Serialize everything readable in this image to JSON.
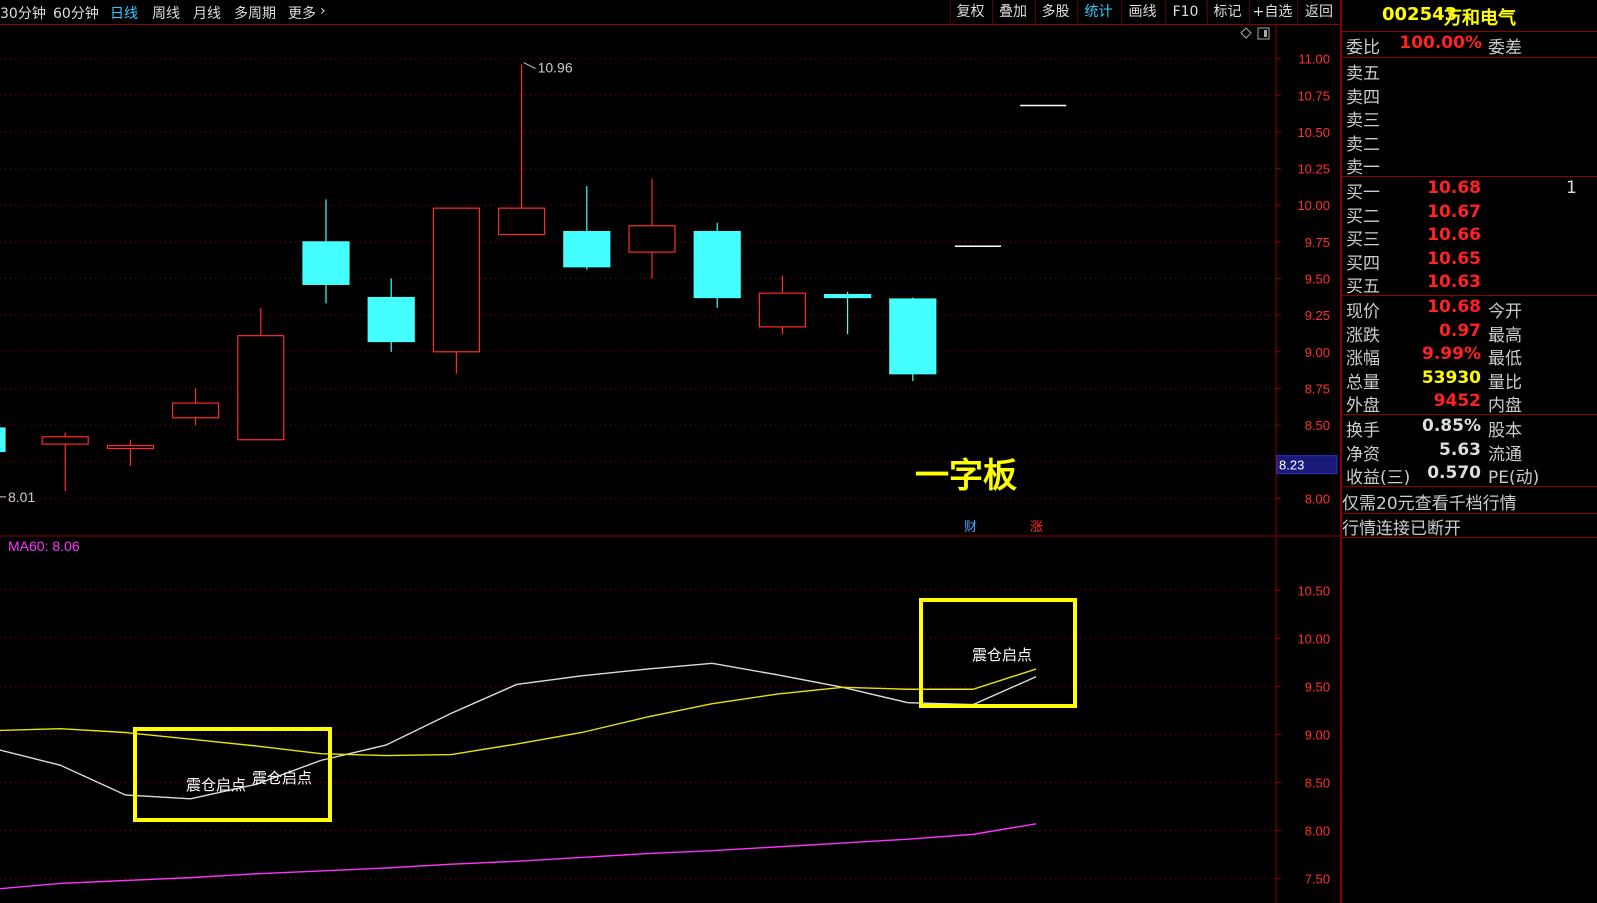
{
  "toolbar": {
    "periods": [
      "30分钟",
      "60分钟",
      "日线",
      "周线",
      "月线",
      "多周期",
      "更多"
    ],
    "active_period": "日线",
    "more_chevron": "›",
    "tools": [
      "复权",
      "叠加",
      "多股",
      "统计",
      "画线",
      "F10",
      "标记",
      "+自选",
      "返回"
    ],
    "active_tool": "统计"
  },
  "colors": {
    "up": "#ff2a2a",
    "down": "#44ffff",
    "grid": "#8b0000",
    "axis_text": "#ff3030",
    "ma_white": "#dddddd",
    "ma_yellow": "#e6e600",
    "ma_magenta": "#ff33ff",
    "highlight_box": "#ffff00"
  },
  "chart_data": [
    {
      "type": "candlestick",
      "ylim": [
        7.9,
        11.1
      ],
      "y_ticks": [
        "11.00",
        "10.75",
        "10.50",
        "10.25",
        "10.00",
        "9.75",
        "9.50",
        "9.25",
        "9.00",
        "8.75",
        "8.50",
        "8.25",
        "8.00"
      ],
      "candles": [
        {
          "open": 8.48,
          "close": 8.32,
          "high": 8.48,
          "low": 8.32
        },
        {
          "open": 8.37,
          "close": 8.42,
          "high": 8.45,
          "low": 8.05
        },
        {
          "open": 8.34,
          "close": 8.36,
          "high": 8.4,
          "low": 8.22
        },
        {
          "open": 8.55,
          "close": 8.65,
          "high": 8.75,
          "low": 8.5
        },
        {
          "open": 8.4,
          "close": 9.11,
          "high": 9.3,
          "low": 8.4
        },
        {
          "open": 9.75,
          "close": 9.46,
          "high": 10.04,
          "low": 9.33
        },
        {
          "open": 9.37,
          "close": 9.07,
          "high": 9.5,
          "low": 9.0
        },
        {
          "open": 9.0,
          "close": 9.98,
          "high": 9.98,
          "low": 8.85
        },
        {
          "open": 9.8,
          "close": 9.98,
          "high": 10.96,
          "low": 9.8
        },
        {
          "open": 9.82,
          "close": 9.58,
          "high": 10.13,
          "low": 9.56
        },
        {
          "open": 9.68,
          "close": 9.86,
          "high": 10.18,
          "low": 9.5
        },
        {
          "open": 9.82,
          "close": 9.37,
          "high": 9.88,
          "low": 9.3
        },
        {
          "open": 9.17,
          "close": 9.4,
          "high": 9.52,
          "low": 9.12
        },
        {
          "open": 9.39,
          "close": 9.37,
          "high": 9.41,
          "low": 9.12
        },
        {
          "open": 9.36,
          "close": 8.85,
          "high": 9.37,
          "low": 8.8
        },
        {
          "open": 9.72,
          "close": 9.72,
          "high": 9.72,
          "low": 9.72
        },
        {
          "open": 10.68,
          "close": 10.68,
          "high": 10.68,
          "low": 10.68
        }
      ],
      "high_label": "10.96",
      "low_label": "8.01",
      "current_price_tag": "8.23",
      "annotation": "一字板",
      "markers": [
        {
          "text": "财",
          "color": "#4da6ff"
        },
        {
          "text": "涨",
          "color": "#ff3030"
        }
      ]
    },
    {
      "type": "line",
      "ylim": [
        7.35,
        10.95
      ],
      "y_ticks": [
        "10.50",
        "10.00",
        "9.50",
        "9.00",
        "8.50",
        "8.00",
        "7.50"
      ],
      "legend": "MA60: 8.06",
      "series": [
        {
          "color": "#dddddd",
          "values": [
            8.85,
            8.68,
            8.37,
            8.33,
            8.48,
            8.73,
            8.89,
            9.22,
            9.52,
            9.61,
            9.68,
            9.74,
            9.62,
            9.49,
            9.33,
            9.31,
            9.6
          ]
        },
        {
          "color": "#e6e600",
          "values": [
            9.04,
            9.06,
            9.02,
            8.95,
            8.88,
            8.8,
            8.78,
            8.79,
            8.9,
            9.02,
            9.18,
            9.32,
            9.42,
            9.49,
            9.47,
            9.47,
            9.68
          ]
        },
        {
          "color": "#ff33ff",
          "values": [
            7.39,
            7.45,
            7.48,
            7.51,
            7.55,
            7.58,
            7.61,
            7.65,
            7.68,
            7.72,
            7.76,
            7.79,
            7.83,
            7.87,
            7.91,
            7.96,
            8.07
          ]
        }
      ],
      "box_labels": [
        "震仓启点",
        "震仓启点",
        "震仓启点"
      ]
    }
  ],
  "panel": {
    "stock_code": "002543",
    "stock_name": "万和电气",
    "weibi_label": "委比",
    "weibi_value": "100.00%",
    "weicha_label": "委差",
    "sell_labels": [
      "卖五",
      "卖四",
      "卖三",
      "卖二",
      "卖一"
    ],
    "buy": [
      {
        "label": "买一",
        "price": "10.68",
        "extra": "1"
      },
      {
        "label": "买二",
        "price": "10.67"
      },
      {
        "label": "买三",
        "price": "10.66"
      },
      {
        "label": "买四",
        "price": "10.65"
      },
      {
        "label": "买五",
        "price": "10.63"
      }
    ],
    "stats1": [
      {
        "label": "现价",
        "value": "10.68",
        "color": "red",
        "ext": "今开"
      },
      {
        "label": "涨跌",
        "value": "0.97",
        "color": "red",
        "ext": "最高"
      },
      {
        "label": "涨幅",
        "value": "9.99%",
        "color": "red",
        "ext": "最低"
      },
      {
        "label": "总量",
        "value": "53930",
        "color": "yellow",
        "ext": "量比"
      },
      {
        "label": "外盘",
        "value": "9452",
        "color": "red",
        "ext": "内盘"
      }
    ],
    "stats2": [
      {
        "label": "换手",
        "value": "0.85%",
        "color": "white",
        "ext": "股本"
      },
      {
        "label": "净资",
        "value": "5.63",
        "color": "white",
        "ext": "流通"
      },
      {
        "label": "收益(三)",
        "value": "0.570",
        "color": "white",
        "ext": "PE(动)"
      }
    ],
    "notice": "仅需20元查看千档行情",
    "status": "行情连接已断开"
  }
}
